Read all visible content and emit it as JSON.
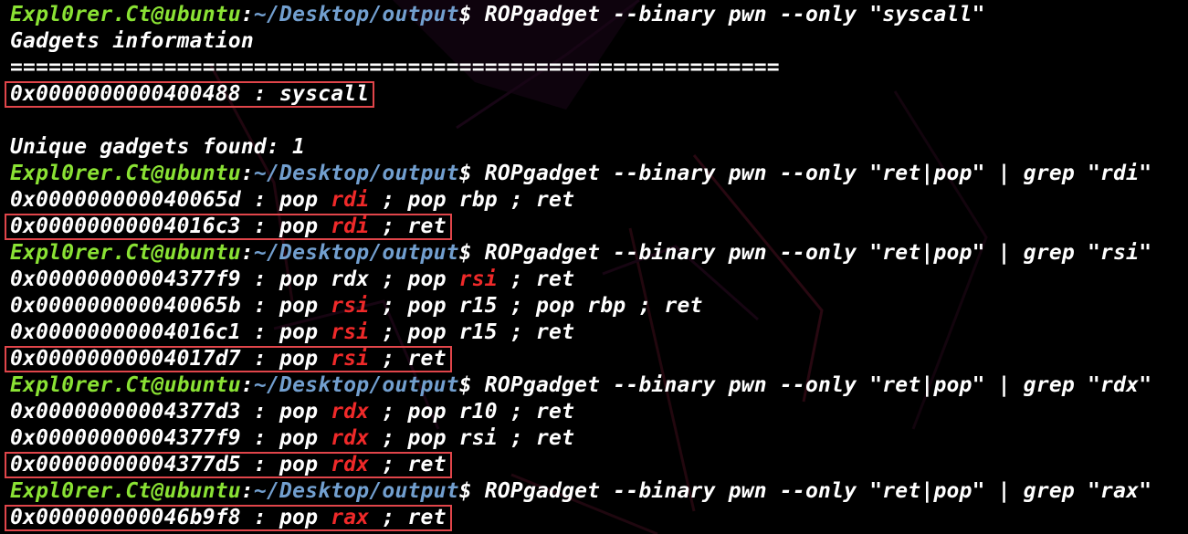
{
  "terminal": {
    "lines": [
      {
        "kind": "prompt",
        "user": "Expl0rer.Ct@ubuntu",
        "colon": ":",
        "path": "~/Desktop/output",
        "dollar": "$ ",
        "command": "ROPgadget --binary pwn --only \"syscall\""
      },
      {
        "kind": "text",
        "text": "Gadgets information"
      },
      {
        "kind": "text",
        "text": "============================================================"
      },
      {
        "kind": "gadget",
        "boxed": true,
        "addr": "0x0000000000400488 : ",
        "parts": [
          {
            "t": "syscall",
            "hl": false
          }
        ]
      },
      {
        "kind": "text",
        "text": ""
      },
      {
        "kind": "text",
        "text": "Unique gadgets found: 1"
      },
      {
        "kind": "prompt",
        "user": "Expl0rer.Ct@ubuntu",
        "colon": ":",
        "path": "~/Desktop/output",
        "dollar": "$ ",
        "command": "ROPgadget --binary pwn --only \"ret|pop\" | grep \"rdi\""
      },
      {
        "kind": "gadget",
        "boxed": false,
        "addr": "0x000000000040065d : ",
        "parts": [
          {
            "t": "pop ",
            "hl": false
          },
          {
            "t": "rdi",
            "hl": true
          },
          {
            "t": " ; pop rbp ; ret",
            "hl": false
          }
        ]
      },
      {
        "kind": "gadget",
        "boxed": true,
        "addr": "0x00000000004016c3 : ",
        "parts": [
          {
            "t": "pop ",
            "hl": false
          },
          {
            "t": "rdi",
            "hl": true
          },
          {
            "t": " ; ret",
            "hl": false
          }
        ]
      },
      {
        "kind": "prompt",
        "user": "Expl0rer.Ct@ubuntu",
        "colon": ":",
        "path": "~/Desktop/output",
        "dollar": "$ ",
        "command": "ROPgadget --binary pwn --only \"ret|pop\" | grep \"rsi\""
      },
      {
        "kind": "gadget",
        "boxed": false,
        "addr": "0x00000000004377f9 : ",
        "parts": [
          {
            "t": "pop rdx ; pop ",
            "hl": false
          },
          {
            "t": "rsi",
            "hl": true
          },
          {
            "t": " ; ret",
            "hl": false
          }
        ]
      },
      {
        "kind": "gadget",
        "boxed": false,
        "addr": "0x000000000040065b : ",
        "parts": [
          {
            "t": "pop ",
            "hl": false
          },
          {
            "t": "rsi",
            "hl": true
          },
          {
            "t": " ; pop r15 ; pop rbp ; ret",
            "hl": false
          }
        ]
      },
      {
        "kind": "gadget",
        "boxed": false,
        "addr": "0x00000000004016c1 : ",
        "parts": [
          {
            "t": "pop ",
            "hl": false
          },
          {
            "t": "rsi",
            "hl": true
          },
          {
            "t": " ; pop r15 ; ret",
            "hl": false
          }
        ]
      },
      {
        "kind": "gadget",
        "boxed": true,
        "addr": "0x00000000004017d7 : ",
        "parts": [
          {
            "t": "pop ",
            "hl": false
          },
          {
            "t": "rsi",
            "hl": true
          },
          {
            "t": " ; ret",
            "hl": false
          }
        ]
      },
      {
        "kind": "prompt",
        "user": "Expl0rer.Ct@ubuntu",
        "colon": ":",
        "path": "~/Desktop/output",
        "dollar": "$ ",
        "command": "ROPgadget --binary pwn --only \"ret|pop\" | grep \"rdx\""
      },
      {
        "kind": "gadget",
        "boxed": false,
        "addr": "0x00000000004377d3 : ",
        "parts": [
          {
            "t": "pop ",
            "hl": false
          },
          {
            "t": "rdx",
            "hl": true
          },
          {
            "t": " ; pop r10 ; ret",
            "hl": false
          }
        ]
      },
      {
        "kind": "gadget",
        "boxed": false,
        "addr": "0x00000000004377f9 : ",
        "parts": [
          {
            "t": "pop ",
            "hl": false
          },
          {
            "t": "rdx",
            "hl": true
          },
          {
            "t": " ; pop rsi ; ret",
            "hl": false
          }
        ]
      },
      {
        "kind": "gadget",
        "boxed": true,
        "addr": "0x00000000004377d5 : ",
        "parts": [
          {
            "t": "pop ",
            "hl": false
          },
          {
            "t": "rdx",
            "hl": true
          },
          {
            "t": " ; ret",
            "hl": false
          }
        ]
      },
      {
        "kind": "prompt",
        "user": "Expl0rer.Ct@ubuntu",
        "colon": ":",
        "path": "~/Desktop/output",
        "dollar": "$ ",
        "command": "ROPgadget --binary pwn --only \"ret|pop\" | grep \"rax\""
      },
      {
        "kind": "gadget",
        "boxed": true,
        "addr": "0x000000000046b9f8 : ",
        "parts": [
          {
            "t": "pop ",
            "hl": false
          },
          {
            "t": "rax",
            "hl": true
          },
          {
            "t": " ; ret",
            "hl": false
          }
        ]
      }
    ]
  },
  "colors": {
    "background": "#000000",
    "prompt_user": "#8ae234",
    "prompt_path": "#729fcf",
    "text": "#ffffff",
    "highlight": "#ef2929",
    "box_outline": "#e0454a"
  }
}
